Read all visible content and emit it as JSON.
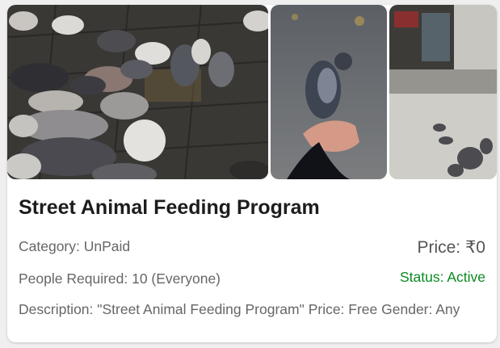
{
  "event": {
    "title": "Street Animal Feeding Program",
    "category": "Category: UnPaid",
    "price": "Price: ₹0",
    "people_required": "People Required: 10 (Everyone)",
    "status": "Status: Active",
    "description": "Description: \"Street Animal Feeding Program\" Price: Free Gender: Any"
  },
  "images": [
    {
      "name": "pigeons-eating-photo"
    },
    {
      "name": "pigeon-on-hand-photo"
    },
    {
      "name": "pigeons-on-street-photo"
    }
  ],
  "colors": {
    "status_active": "#0a8a21",
    "title": "#1d1d1d",
    "text": "#666666"
  }
}
